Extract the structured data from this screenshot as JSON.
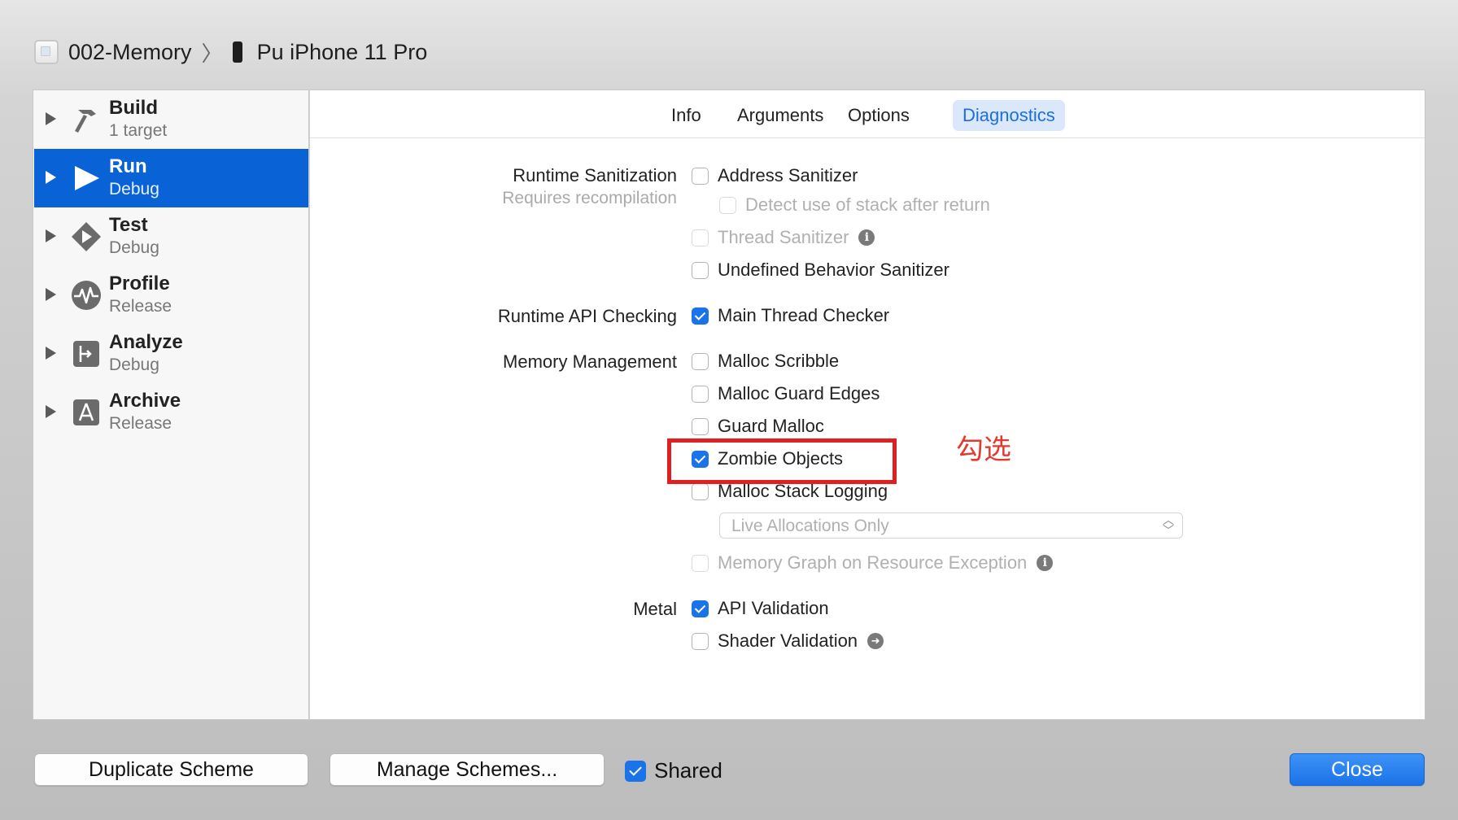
{
  "breadcrumb": {
    "project": "002-Memory",
    "device": "Pu iPhone 11 Pro"
  },
  "sidebar": {
    "items": [
      {
        "title": "Build",
        "subtitle": "1 target",
        "icon": "hammer-icon",
        "selected": false
      },
      {
        "title": "Run",
        "subtitle": "Debug",
        "icon": "play-icon",
        "selected": true
      },
      {
        "title": "Test",
        "subtitle": "Debug",
        "icon": "diamond-play-icon",
        "selected": false
      },
      {
        "title": "Profile",
        "subtitle": "Release",
        "icon": "waveform-icon",
        "selected": false
      },
      {
        "title": "Analyze",
        "subtitle": "Debug",
        "icon": "analyze-icon",
        "selected": false
      },
      {
        "title": "Archive",
        "subtitle": "Release",
        "icon": "archive-icon",
        "selected": false
      }
    ]
  },
  "tabs": [
    "Info",
    "Arguments",
    "Options",
    "Diagnostics"
  ],
  "active_tab": "Diagnostics",
  "sections": {
    "runtime_sanitization": {
      "label": "Runtime Sanitization",
      "sublabel": "Requires recompilation"
    },
    "runtime_api_checking": {
      "label": "Runtime API Checking"
    },
    "memory_management": {
      "label": "Memory Management"
    },
    "metal": {
      "label": "Metal"
    }
  },
  "options": {
    "address_sanitizer": {
      "label": "Address Sanitizer",
      "checked": false,
      "enabled": true
    },
    "detect_stack": {
      "label": "Detect use of stack after return",
      "checked": false,
      "enabled": false
    },
    "thread_sanitizer": {
      "label": "Thread Sanitizer",
      "checked": false,
      "enabled": false
    },
    "undefined_behavior": {
      "label": "Undefined Behavior Sanitizer",
      "checked": false,
      "enabled": true
    },
    "main_thread_checker": {
      "label": "Main Thread Checker",
      "checked": true,
      "enabled": true
    },
    "malloc_scribble": {
      "label": "Malloc Scribble",
      "checked": false,
      "enabled": true
    },
    "malloc_guard_edges": {
      "label": "Malloc Guard Edges",
      "checked": false,
      "enabled": true
    },
    "guard_malloc": {
      "label": "Guard Malloc",
      "checked": false,
      "enabled": true
    },
    "zombie_objects": {
      "label": "Zombie Objects",
      "checked": true,
      "enabled": true
    },
    "malloc_stack_logging": {
      "label": "Malloc Stack Logging",
      "checked": false,
      "enabled": true
    },
    "memory_graph": {
      "label": "Memory Graph on Resource Exception",
      "checked": false,
      "enabled": false
    },
    "api_validation": {
      "label": "API Validation",
      "checked": true,
      "enabled": true
    },
    "shader_validation": {
      "label": "Shader Validation",
      "checked": false,
      "enabled": true
    }
  },
  "stack_logging_popup": {
    "value": "Live Allocations Only"
  },
  "annotation": "勾选",
  "footer": {
    "duplicate_label": "Duplicate Scheme",
    "manage_label": "Manage Schemes...",
    "shared_label": "Shared",
    "shared_checked": true,
    "close_label": "Close"
  },
  "colors": {
    "accent": "#1a73e8",
    "selection": "#0a63d6",
    "annotation": "#e02020"
  }
}
